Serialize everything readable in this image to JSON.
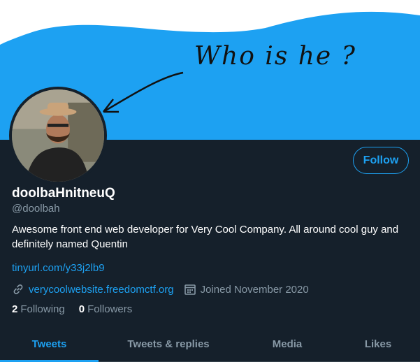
{
  "banner": {
    "annotation": "Who is he ?",
    "colors": {
      "sky": "#1da1f2",
      "white": "#ffffff"
    }
  },
  "profile": {
    "display_name": "doolbaHnitneuQ",
    "handle": "@doolbah",
    "bio": "Awesome front end web developer for Very Cool Company. All around cool guy and definitely named Quentin",
    "short_link": "tinyurl.com/y33j2lb9",
    "website": "verycoolwebsite.freedomctf.org",
    "joined": "Joined November 2020",
    "follow_label": "Follow",
    "following_count": "2",
    "following_label": "Following",
    "followers_count": "0",
    "followers_label": "Followers"
  },
  "tabs": [
    {
      "label": "Tweets",
      "active": true
    },
    {
      "label": "Tweets & replies"
    },
    {
      "label": "Media"
    },
    {
      "label": "Likes"
    }
  ],
  "icons": {
    "link": "link-icon",
    "calendar": "calendar-icon"
  },
  "colors": {
    "accent": "#1da1f2",
    "bg": "#15202b",
    "muted": "#8899a6"
  }
}
